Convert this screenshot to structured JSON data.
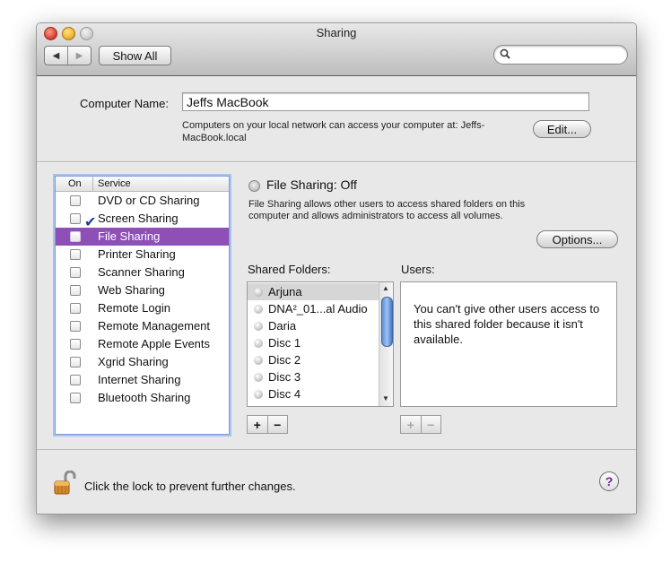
{
  "window": {
    "title": "Sharing"
  },
  "toolbar": {
    "show_all": "Show All",
    "search_placeholder": "",
    "search_value": ""
  },
  "computer": {
    "label": "Computer Name:",
    "name": "Jeffs MacBook",
    "note": "Computers on your local network can access your computer at: Jeffs-MacBook.local",
    "edit_label": "Edit..."
  },
  "services": {
    "header_on": "On",
    "header_service": "Service",
    "items": [
      {
        "label": "DVD or CD Sharing",
        "checked": false
      },
      {
        "label": "Screen Sharing",
        "checked": true
      },
      {
        "label": "File Sharing",
        "checked": false,
        "selected": true
      },
      {
        "label": "Printer Sharing",
        "checked": false
      },
      {
        "label": "Scanner Sharing",
        "checked": false
      },
      {
        "label": "Web Sharing",
        "checked": false
      },
      {
        "label": "Remote Login",
        "checked": false
      },
      {
        "label": "Remote Management",
        "checked": false
      },
      {
        "label": "Remote Apple Events",
        "checked": false
      },
      {
        "label": "Xgrid Sharing",
        "checked": false
      },
      {
        "label": "Internet Sharing",
        "checked": false
      },
      {
        "label": "Bluetooth Sharing",
        "checked": false
      }
    ]
  },
  "file_sharing": {
    "status": "File Sharing: Off",
    "description": "File Sharing allows other users to access shared folders on this computer and allows administrators to access all volumes.",
    "options_label": "Options...",
    "shared_folders_label": "Shared Folders:",
    "users_label": "Users:",
    "folders": [
      "Arjuna",
      "DNA²_01...al Audio",
      "Daria",
      "Disc 1",
      "Disc 2",
      "Disc 3",
      "Disc 4"
    ],
    "users_message": "You can't give other users access to this shared folder because it isn't available.",
    "add": "+",
    "remove": "−"
  },
  "footer": {
    "lock_text": "Click the lock to prevent further changes.",
    "help": "?"
  },
  "colors": {
    "selection": "#8e4fb6",
    "help_mark": "#7a1f9b"
  }
}
